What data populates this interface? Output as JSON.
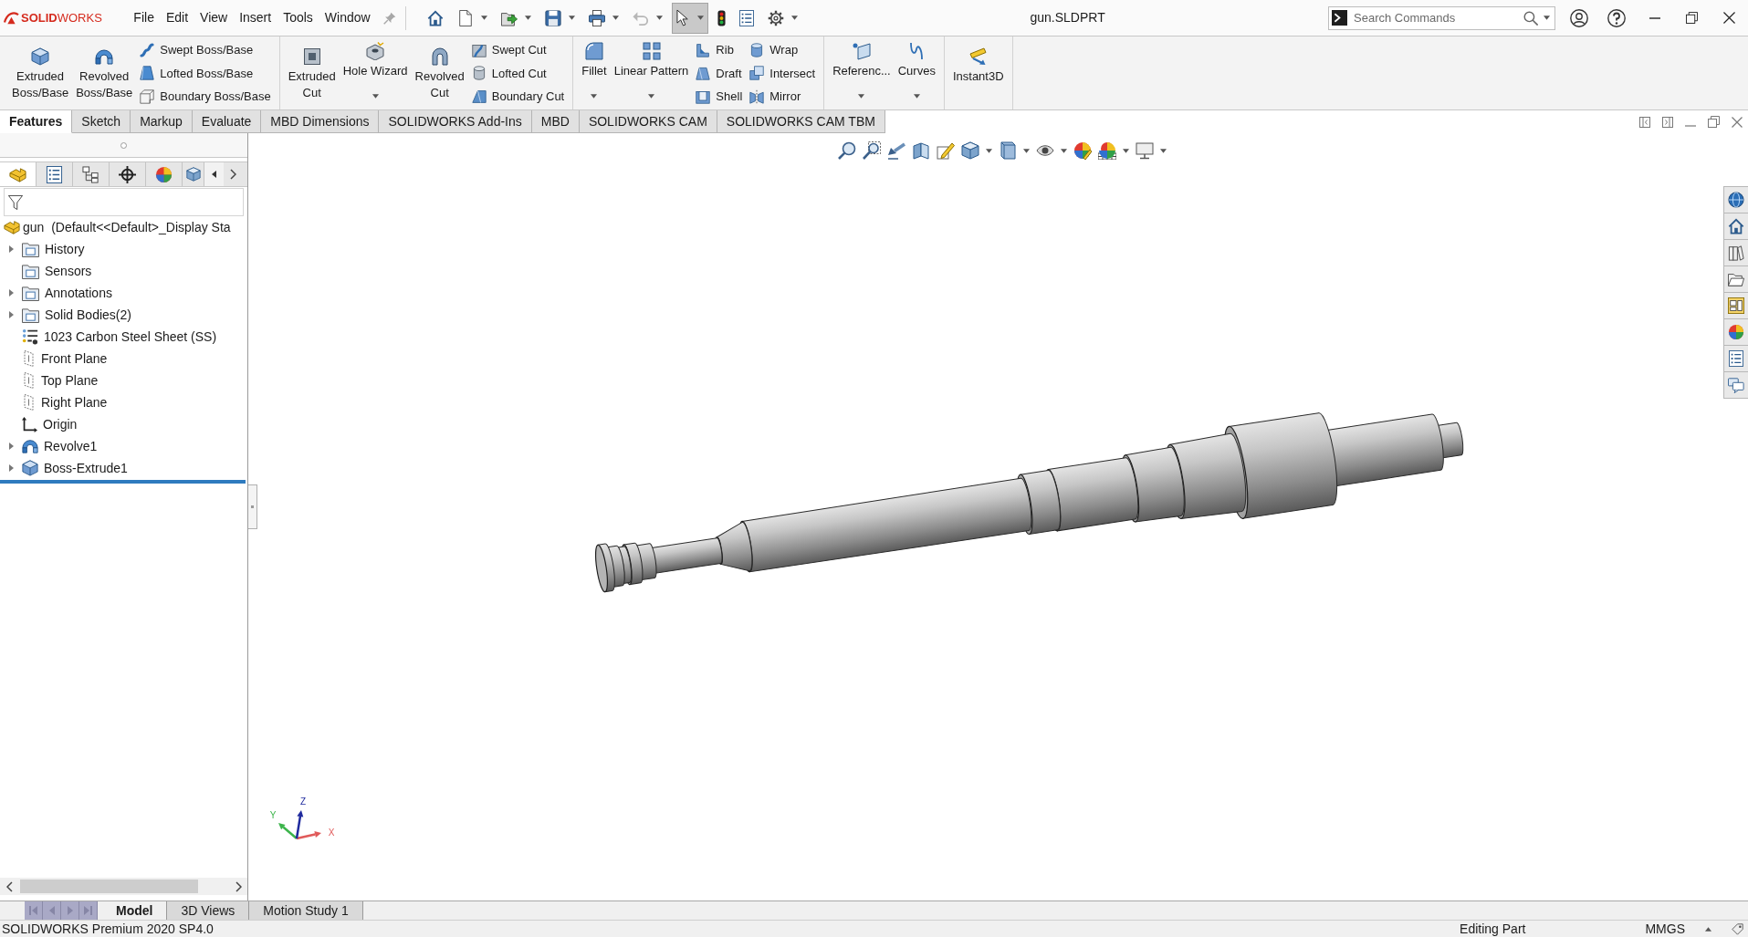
{
  "title_bar": {
    "logo": "**SOLID**WORKS",
    "menu": [
      {
        "label": "File"
      },
      {
        "label": "Edit"
      },
      {
        "label": "View"
      },
      {
        "label": "Insert"
      },
      {
        "label": "Tools"
      },
      {
        "label": "Window"
      }
    ],
    "quick_access": [
      {
        "dropdown": false,
        "disabled": false,
        "pressed": false
      },
      {
        "dropdown": true,
        "disabled": false,
        "pressed": false
      },
      {
        "dropdown": true,
        "disabled": false,
        "pressed": false
      },
      {
        "dropdown": true,
        "disabled": false,
        "pressed": false
      },
      {
        "dropdown": true,
        "disabled": false,
        "pressed": false
      },
      {
        "dropdown": true,
        "disabled": true,
        "pressed": false
      },
      {
        "dropdown": true,
        "disabled": false,
        "pressed": true
      },
      {
        "dropdown": false,
        "disabled": false,
        "pressed": false
      },
      {
        "dropdown": false,
        "disabled": false,
        "pressed": false
      },
      {
        "dropdown": true,
        "disabled": false,
        "pressed": false
      }
    ],
    "document_title": "gun.SLDPRT",
    "search": {
      "placeholder": "Search Commands"
    }
  },
  "ribbon": {
    "groups": [
      {
        "items": [
          {
            "kind": "large",
            "label": "Extruded Boss/Base",
            "dropdown": false
          },
          {
            "kind": "large",
            "label": "Revolved Boss/Base",
            "dropdown": false
          },
          {
            "kind": "stack",
            "commands": [
              {
                "label": "Swept Boss/Base"
              },
              {
                "label": "Lofted Boss/Base"
              },
              {
                "label": "Boundary Boss/Base"
              }
            ]
          }
        ]
      },
      {
        "items": [
          {
            "kind": "large",
            "label": "Extruded Cut",
            "dropdown": false
          },
          {
            "kind": "large",
            "label": "Hole Wizard",
            "dropdown": true
          },
          {
            "kind": "large",
            "label": "Revolved Cut",
            "dropdown": false
          },
          {
            "kind": "stack",
            "commands": [
              {
                "label": "Swept Cut"
              },
              {
                "label": "Lofted Cut"
              },
              {
                "label": "Boundary Cut"
              }
            ]
          }
        ]
      },
      {
        "items": [
          {
            "kind": "large",
            "label": "Fillet",
            "dropdown": true
          },
          {
            "kind": "large",
            "label": "Linear Pattern",
            "dropdown": true
          },
          {
            "kind": "stack",
            "commands": [
              {
                "label": "Rib"
              },
              {
                "label": "Draft"
              },
              {
                "label": "Shell"
              }
            ]
          },
          {
            "kind": "stack",
            "commands": [
              {
                "label": "Wrap"
              },
              {
                "label": "Intersect"
              },
              {
                "label": "Mirror"
              }
            ]
          }
        ]
      },
      {
        "items": [
          {
            "kind": "large",
            "label": "Referenc...",
            "dropdown": true
          },
          {
            "kind": "large",
            "label": "Curves",
            "dropdown": true
          }
        ]
      },
      {
        "items": [
          {
            "kind": "large",
            "label": "Instant3D",
            "dropdown": false
          }
        ]
      }
    ]
  },
  "command_tabs": [
    {
      "label": "Features",
      "selected": true
    },
    {
      "label": "Sketch",
      "selected": false
    },
    {
      "label": "Markup",
      "selected": false
    },
    {
      "label": "Evaluate",
      "selected": false
    },
    {
      "label": "MBD Dimensions",
      "selected": false
    },
    {
      "label": "SOLIDWORKS Add-Ins",
      "selected": false
    },
    {
      "label": "MBD",
      "selected": false
    },
    {
      "label": "SOLIDWORKS CAM",
      "selected": false
    },
    {
      "label": "SOLIDWORKS CAM TBM",
      "selected": false
    }
  ],
  "feature_manager": {
    "panel_tabs": [
      {
        "selected": true
      },
      {
        "selected": false
      },
      {
        "selected": false
      },
      {
        "selected": false
      },
      {
        "selected": false
      },
      {
        "selected": false
      }
    ],
    "tree": {
      "label": "gun  (Default<<Default>_Display Sta",
      "children": [
        {
          "label": "History",
          "expandable": true
        },
        {
          "label": "Sensors",
          "expandable": false
        },
        {
          "label": "Annotations",
          "expandable": true
        },
        {
          "label": "Solid Bodies(2)",
          "expandable": true
        },
        {
          "label": "1023 Carbon Steel Sheet (SS)",
          "expandable": false
        },
        {
          "label": "Front Plane",
          "expandable": false
        },
        {
          "label": "Top Plane",
          "expandable": false
        },
        {
          "label": "Right Plane",
          "expandable": false
        },
        {
          "label": "Origin",
          "expandable": false
        },
        {
          "label": "Revolve1",
          "expandable": true
        },
        {
          "label": "Boss-Extrude1",
          "expandable": true
        }
      ]
    }
  },
  "triad": {
    "axes": [
      {
        "label": "X",
        "color": "#e05a5a"
      },
      {
        "label": "Y",
        "color": "#3cb44b"
      },
      {
        "label": "Z",
        "color": "#1f2a9e"
      }
    ]
  },
  "model_tabs": [
    {
      "label": "Model",
      "selected": true
    },
    {
      "label": "3D Views",
      "selected": false
    },
    {
      "label": "Motion Study 1",
      "selected": false
    }
  ],
  "status_bar": {
    "product": "SOLIDWORKS Premium 2020 SP4.0",
    "mode": "Editing Part",
    "units": "MMGS"
  }
}
